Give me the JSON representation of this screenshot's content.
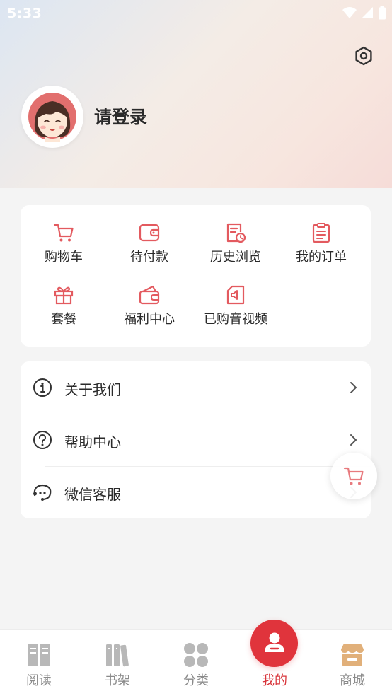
{
  "status_bar": {
    "time": "5:33"
  },
  "profile": {
    "login_prompt": "请登录",
    "avatar_icon": "girl-avatar-icon"
  },
  "services": [
    {
      "label": "购物车",
      "icon": "cart-icon"
    },
    {
      "label": "待付款",
      "icon": "wallet-icon"
    },
    {
      "label": "历史浏览",
      "icon": "history-icon"
    },
    {
      "label": "我的订单",
      "icon": "clipboard-icon"
    },
    {
      "label": "套餐",
      "icon": "gift-icon"
    },
    {
      "label": "福利中心",
      "icon": "coupon-icon"
    },
    {
      "label": "已购音视频",
      "icon": "media-icon"
    }
  ],
  "menu": [
    {
      "label": "关于我们",
      "icon": "info-icon"
    },
    {
      "label": "帮助中心",
      "icon": "help-icon"
    },
    {
      "label": "微信客服",
      "icon": "chat-service-icon"
    }
  ],
  "bottom_nav": [
    {
      "label": "阅读",
      "icon": "book-icon"
    },
    {
      "label": "书架",
      "icon": "bookshelf-icon"
    },
    {
      "label": "分类",
      "icon": "category-icon"
    },
    {
      "label": "我的",
      "icon": "user-icon",
      "active": true
    },
    {
      "label": "商城",
      "icon": "store-icon"
    }
  ],
  "colors": {
    "accent": "#e0343c",
    "icon_red": "#e35a5f",
    "store_tan": "#e1b07a",
    "inactive": "#b8b8b8"
  }
}
